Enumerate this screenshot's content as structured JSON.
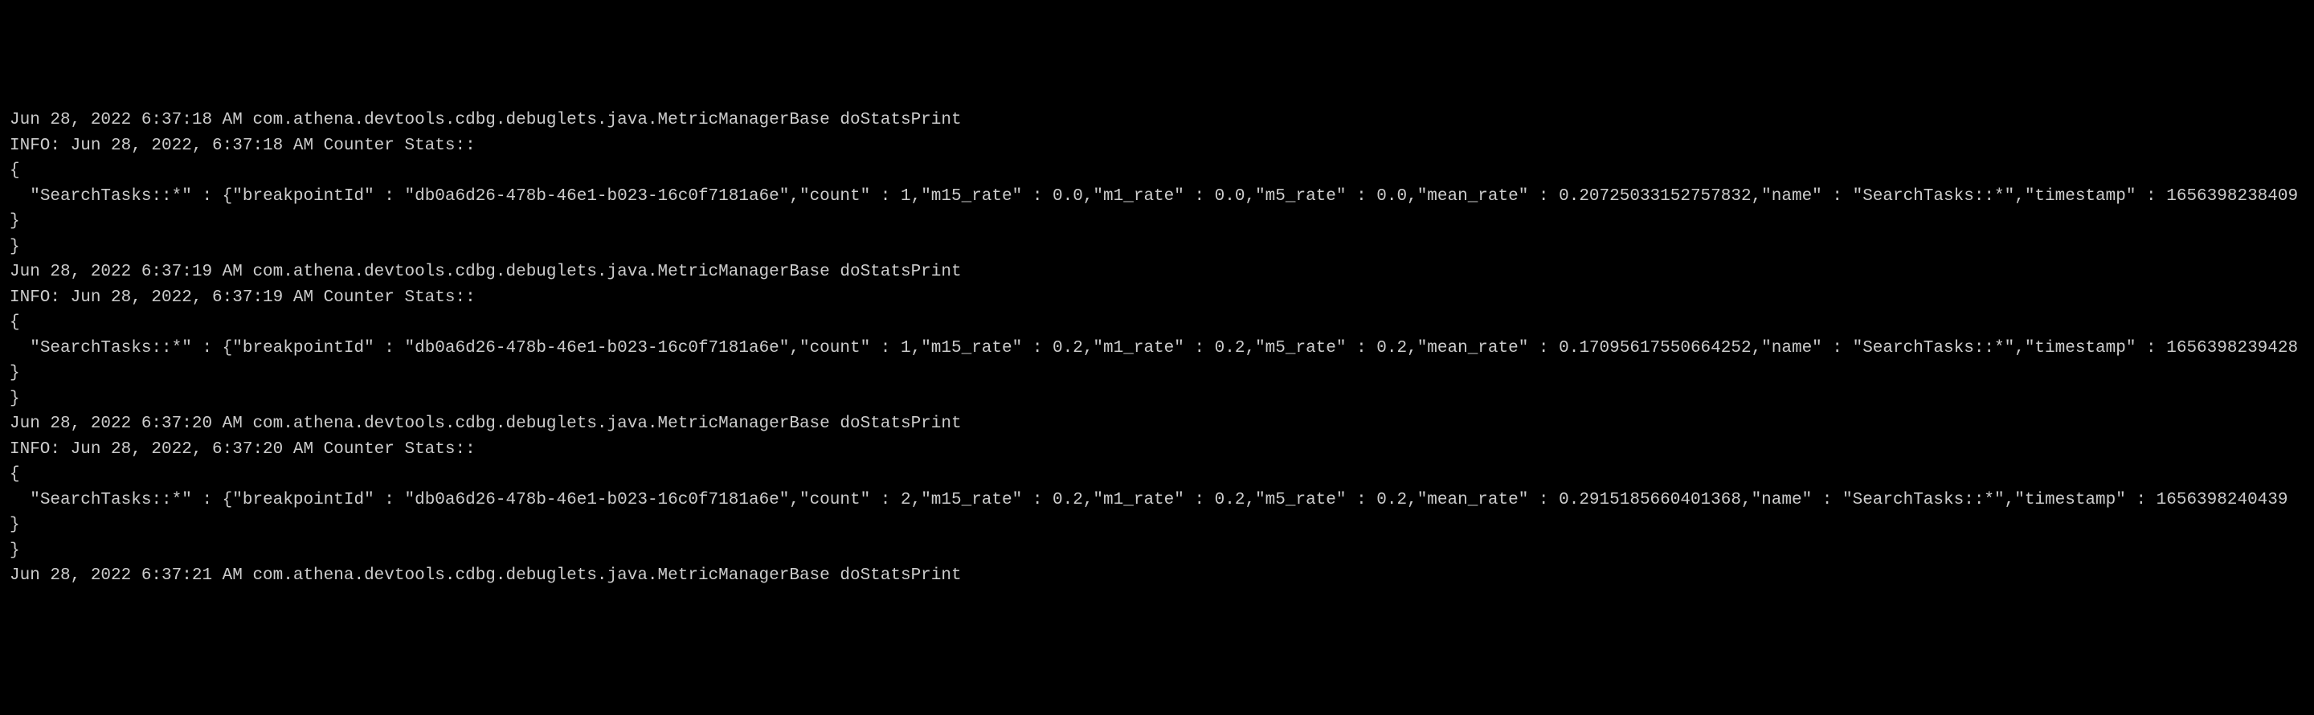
{
  "logs": [
    {
      "header": "Jun 28, 2022 6:37:18 AM com.athena.devtools.cdbg.debuglets.java.MetricManagerBase doStatsPrint",
      "info": "INFO: Jun 28, 2022, 6:37:18 AM Counter Stats::",
      "open": "{",
      "body": "  \"SearchTasks::*\" : {\"breakpointId\" : \"db0a6d26-478b-46e1-b023-16c0f7181a6e\",\"count\" : 1,\"m15_rate\" : 0.0,\"m1_rate\" : 0.0,\"m5_rate\" : 0.0,\"mean_rate\" : 0.20725033152757832,\"name\" : \"SearchTasks::*\",\"timestamp\" : 1656398238409  }",
      "close": "}"
    },
    {
      "header": "Jun 28, 2022 6:37:19 AM com.athena.devtools.cdbg.debuglets.java.MetricManagerBase doStatsPrint",
      "info": "INFO: Jun 28, 2022, 6:37:19 AM Counter Stats::",
      "open": "{",
      "body": "  \"SearchTasks::*\" : {\"breakpointId\" : \"db0a6d26-478b-46e1-b023-16c0f7181a6e\",\"count\" : 1,\"m15_rate\" : 0.2,\"m1_rate\" : 0.2,\"m5_rate\" : 0.2,\"mean_rate\" : 0.17095617550664252,\"name\" : \"SearchTasks::*\",\"timestamp\" : 1656398239428  }",
      "close": "}"
    },
    {
      "header": "Jun 28, 2022 6:37:20 AM com.athena.devtools.cdbg.debuglets.java.MetricManagerBase doStatsPrint",
      "info": "INFO: Jun 28, 2022, 6:37:20 AM Counter Stats::",
      "open": "{",
      "body": "  \"SearchTasks::*\" : {\"breakpointId\" : \"db0a6d26-478b-46e1-b023-16c0f7181a6e\",\"count\" : 2,\"m15_rate\" : 0.2,\"m1_rate\" : 0.2,\"m5_rate\" : 0.2,\"mean_rate\" : 0.2915185660401368,\"name\" : \"SearchTasks::*\",\"timestamp\" : 1656398240439  }",
      "close": "}"
    }
  ],
  "partial": "Jun 28, 2022 6:37:21 AM com.athena.devtools.cdbg.debuglets.java.MetricManagerBase doStatsPrint"
}
